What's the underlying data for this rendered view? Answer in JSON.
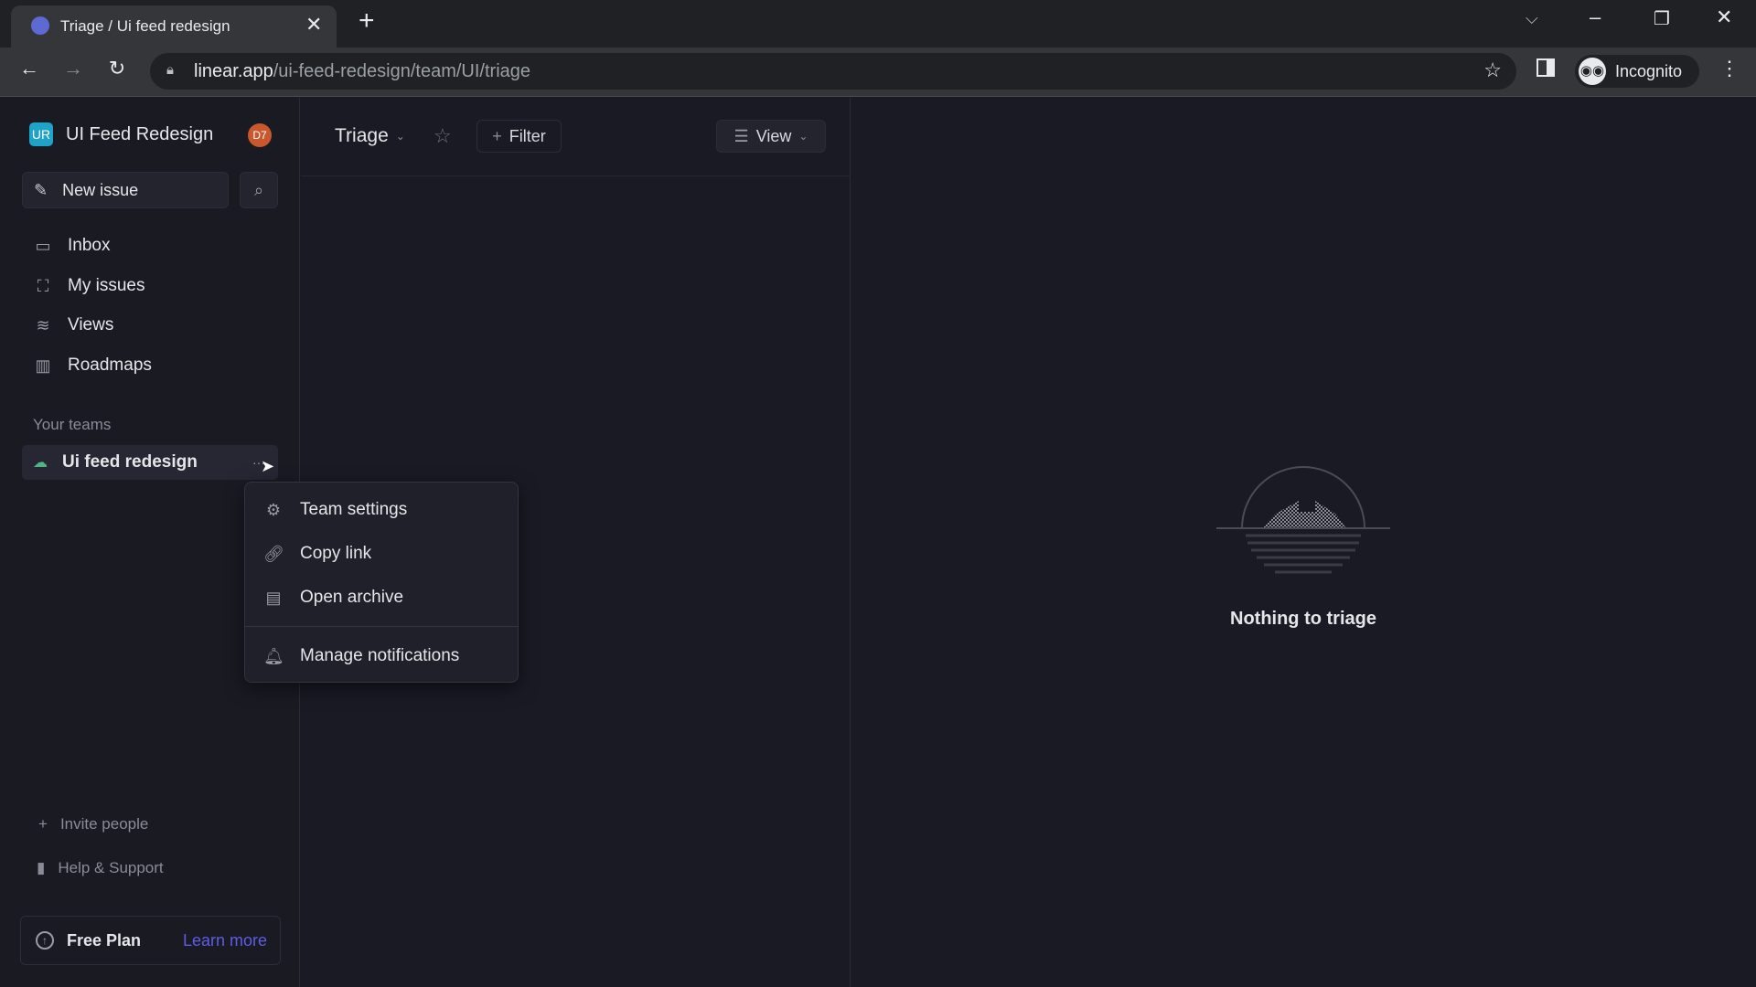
{
  "browser": {
    "tab_title": "Triage / Ui feed redesign",
    "url_domain": "linear.app",
    "url_path": "/ui-feed-redesign/team/UI/triage",
    "profile": "Incognito"
  },
  "workspace": {
    "initials": "UR",
    "name": "UI Feed Redesign",
    "avatar": "D7",
    "accent": "#1fa3c7",
    "avatar_color": "#c9582d"
  },
  "sidebar": {
    "new_issue": "New issue",
    "items": [
      {
        "label": "Inbox",
        "icon": "inbox-icon"
      },
      {
        "label": "My issues",
        "icon": "my-issues-icon"
      },
      {
        "label": "Views",
        "icon": "layers-icon"
      },
      {
        "label": "Roadmaps",
        "icon": "map-icon"
      }
    ],
    "teams_heading": "Your teams",
    "team": "Ui feed redesign",
    "team_more": "···",
    "invite": "Invite people",
    "help": "Help & Support",
    "plan": "Free Plan",
    "learn_more": "Learn more",
    "learn_more_color": "#5e5ce6"
  },
  "header": {
    "title": "Triage",
    "filter": "Filter",
    "view": "View"
  },
  "menu": {
    "items": [
      "Team settings",
      "Copy link",
      "Open archive",
      "Manage notifications"
    ]
  },
  "empty": {
    "message": "Nothing to triage"
  }
}
